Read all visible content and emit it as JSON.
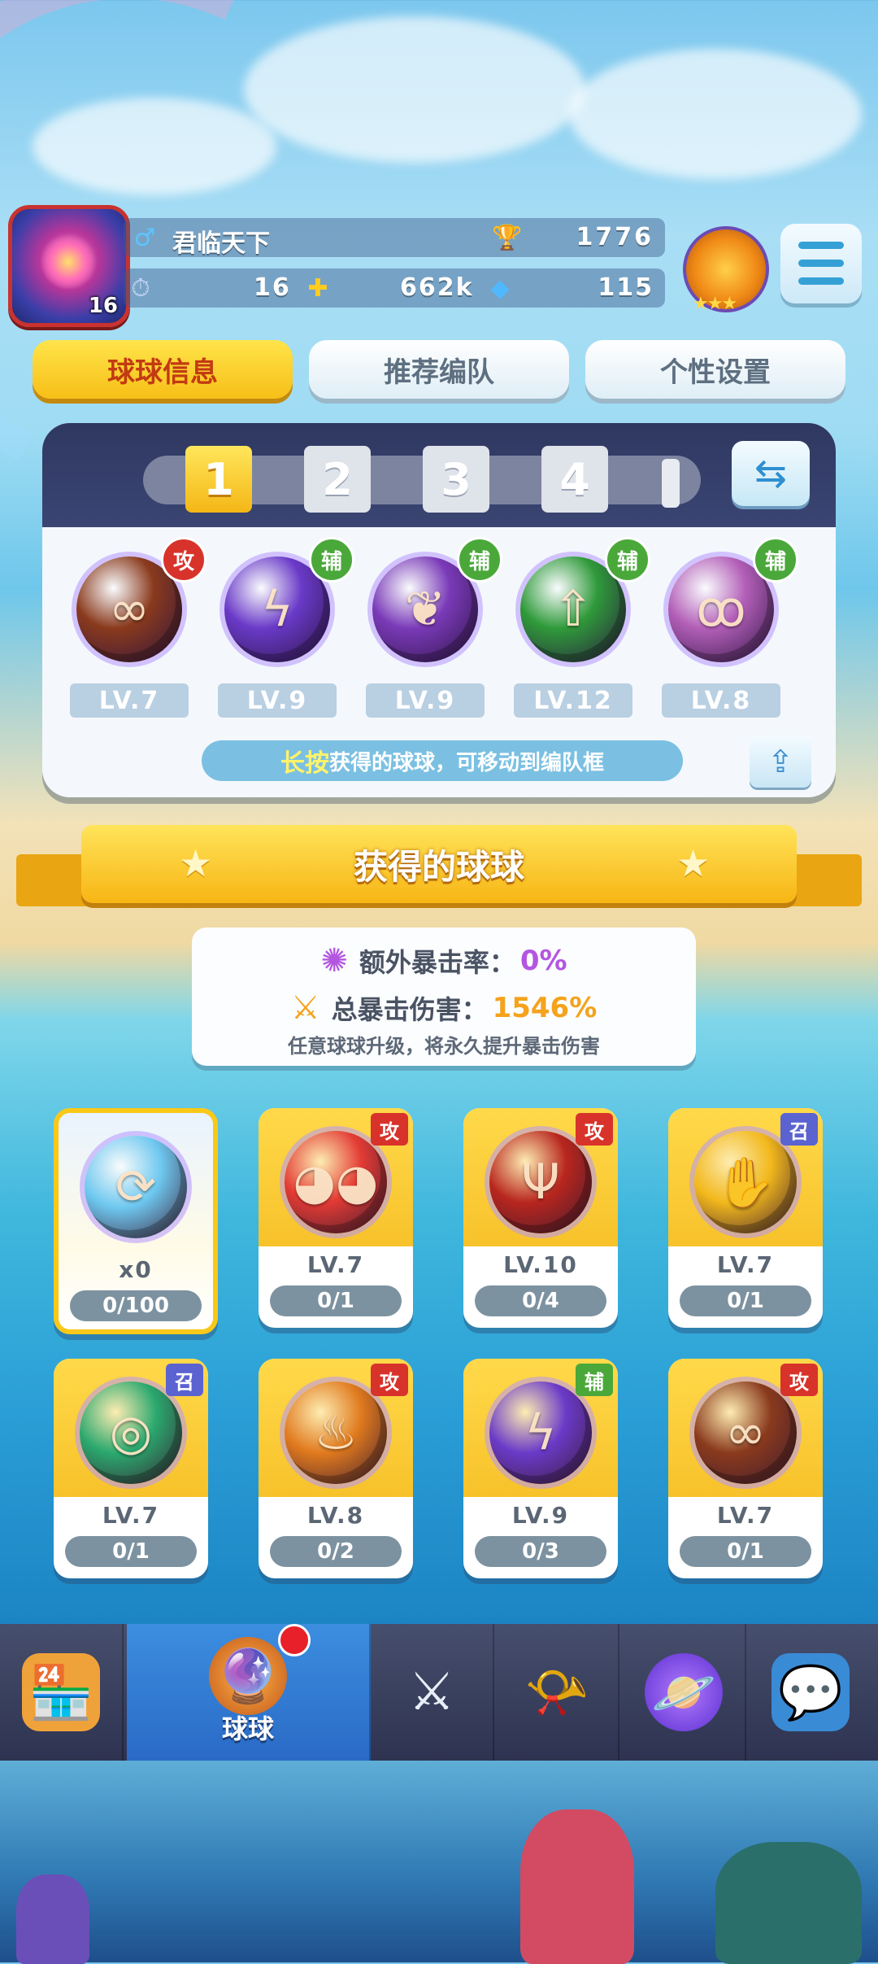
{
  "player": {
    "name": "君临天下",
    "level": "16",
    "trophies": "1776",
    "energy": "16",
    "coins": "662k",
    "gems": "115"
  },
  "tabs": [
    "球球信息",
    "推荐编队",
    "个性设置"
  ],
  "team": {
    "slots": [
      "1",
      "2",
      "3",
      "4"
    ],
    "balls": [
      {
        "role": "攻",
        "level": "LV.7",
        "color": "#8a3a1d",
        "icon": "infinity-icon"
      },
      {
        "role": "辅",
        "level": "LV.9",
        "color": "#6a3ac8",
        "icon": "lightning-icon"
      },
      {
        "role": "辅",
        "level": "LV.9",
        "color": "#7a3ab8",
        "icon": "leaf-icon"
      },
      {
        "role": "辅",
        "level": "LV.12",
        "color": "#2f9a3a",
        "icon": "arrow-up-icon"
      },
      {
        "role": "辅",
        "level": "LV.8",
        "color": "#b35fb8",
        "icon": "people-icon"
      }
    ],
    "hint_highlight": "长按",
    "hint_text": "获得的球球，可移动到编队框"
  },
  "section_title": "获得的球球",
  "crit": {
    "extra_label": "额外暴击率：",
    "extra_value": "0%",
    "total_label": "总暴击伤害：",
    "total_value": "1546%",
    "note": "任意球球升级，将永久提升暴击伤害"
  },
  "collection": [
    {
      "special": true,
      "count": "x0",
      "progress": "0/100",
      "color": "#6ec8f0",
      "icon": "refresh-icon"
    },
    {
      "role": "攻",
      "level": "LV.7",
      "progress": "0/1",
      "color": "#e33b34",
      "icon": "face-icon"
    },
    {
      "role": "攻",
      "level": "LV.10",
      "progress": "0/4",
      "color": "#b8261e",
      "icon": "trident-icon"
    },
    {
      "role": "召",
      "level": "LV.7",
      "progress": "0/1",
      "color": "#f2b81c",
      "icon": "hand-icon"
    },
    {
      "role": "召",
      "level": "LV.7",
      "progress": "0/1",
      "color": "#2aa86e",
      "icon": "portal-icon"
    },
    {
      "role": "攻",
      "level": "LV.8",
      "progress": "0/2",
      "color": "#e07a1e",
      "icon": "flame-icon"
    },
    {
      "role": "辅",
      "level": "LV.9",
      "progress": "0/3",
      "color": "#6a3ac8",
      "icon": "lightning-icon"
    },
    {
      "role": "攻",
      "level": "LV.7",
      "progress": "0/1",
      "color": "#8a3a1d",
      "icon": "infinity-icon"
    }
  ],
  "nav": {
    "active_label": "球球",
    "items": [
      "shop-icon",
      "balls-icon",
      "battle-icon",
      "whistle-icon",
      "planet-icon",
      "chat-icon"
    ]
  },
  "colors": {
    "accent_yellow": "#f7c22a",
    "attack_red": "#d8332b",
    "support_green": "#4aa83a",
    "summon_blue": "#5a63d0",
    "crit_purple": "#b455e0",
    "crit_orange": "#f5a21c"
  }
}
